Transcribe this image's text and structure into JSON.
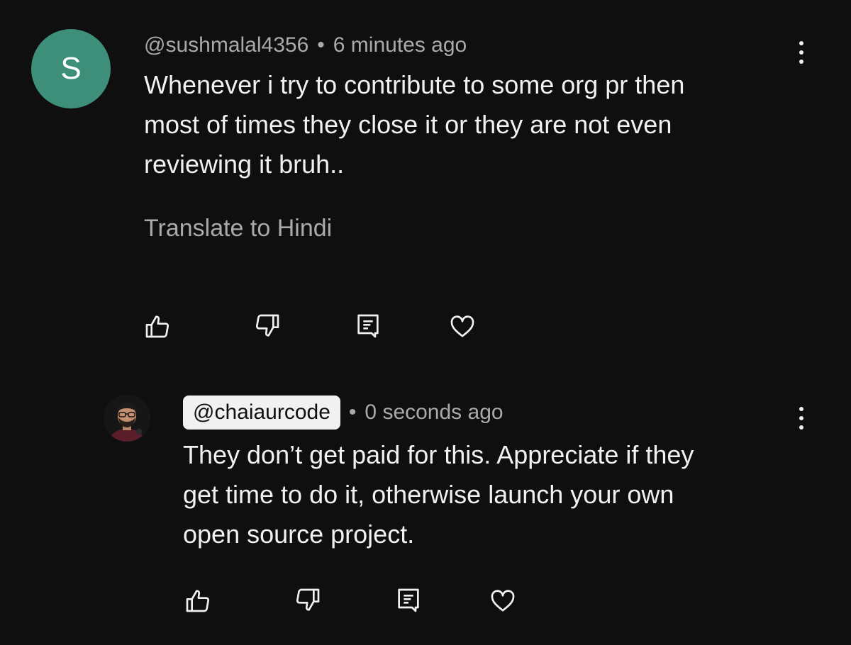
{
  "comment": {
    "avatar_letter": "S",
    "avatar_color": "#3d8f79",
    "author": "@sushmalal4356",
    "separator": "•",
    "timestamp": "6 minutes ago",
    "text": "Whenever i try to contribute to some org pr then\nmost of times they close it or they are not even\nreviewing it bruh..",
    "translate_label": "Translate to Hindi",
    "actions": {
      "like_icon": "thumbs-up-icon",
      "dislike_icon": "thumbs-down-icon",
      "reply_icon": "reply-comment-icon",
      "heart_icon": "heart-icon"
    },
    "menu_icon": "more-vert-icon"
  },
  "reply": {
    "author": "@chaiaurcode",
    "separator": "•",
    "timestamp": "0 seconds ago",
    "text": "They don’t get paid for this. Appreciate if they\nget time to do it, otherwise launch your own\nopen source project.",
    "actions": {
      "like_icon": "thumbs-up-icon",
      "dislike_icon": "thumbs-down-icon",
      "reply_icon": "reply-comment-icon",
      "heart_icon": "heart-icon"
    },
    "menu_icon": "more-vert-icon"
  },
  "colors": {
    "background": "#0f0f0f",
    "text_primary": "#f1f1f1",
    "text_secondary": "#aaaaaa",
    "channel_chip_bg": "#f1f1f1"
  }
}
